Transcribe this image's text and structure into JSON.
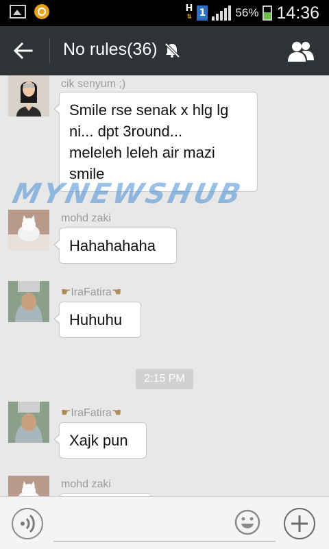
{
  "status_bar": {
    "network_letter": "H",
    "sim_number": "1",
    "battery_percent": "56%",
    "time": "14:36"
  },
  "header": {
    "title": "No rules(36)",
    "icons": [
      "back-arrow-icon",
      "mute-icon",
      "group-members-icon"
    ]
  },
  "watermark": "MYNEWSHUB",
  "messages": [
    {
      "sender": "cik senyum ;)",
      "text_lines": [
        "Smile rse senak x hlg lg",
        "ni... dpt 3round...",
        "meleleh leleh air mazi",
        "smile"
      ]
    },
    {
      "sender": "mohd zaki",
      "text": "Hahahahaha"
    },
    {
      "sender": "IraFatira",
      "text": "Huhuhu"
    },
    {
      "sender": "IraFatira",
      "text": "Xajk pun"
    },
    {
      "sender": "mohd zaki",
      "text": ""
    }
  ],
  "timestamp": "2:15 PM",
  "input_bar": {
    "placeholder": "",
    "icons": [
      "voice-icon",
      "emoji-icon",
      "plus-icon"
    ]
  },
  "colors": {
    "status_bar_bg": "#000000",
    "header_bg": "#2e3336",
    "chat_bg": "#e8e8e8",
    "bubble_bg": "#ffffff",
    "watermark": "#468cd2"
  }
}
